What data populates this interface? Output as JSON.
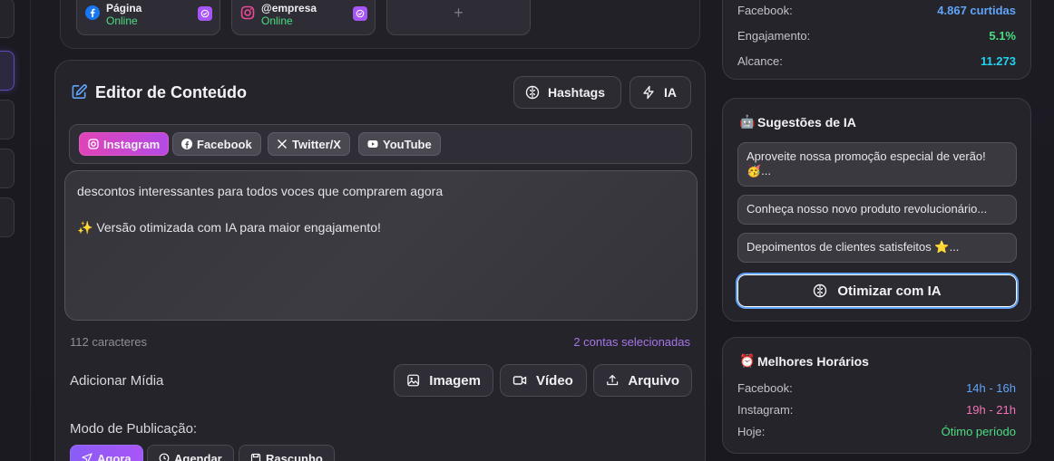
{
  "accounts": [
    {
      "name": "Página",
      "status": "Online",
      "network_icon": "facebook-icon",
      "checked": true
    },
    {
      "name": "@empresa",
      "status": "Online",
      "network_icon": "instagram-icon",
      "checked": true
    }
  ],
  "add_account_label": "+",
  "editor": {
    "title": "Editor de Conteúdo",
    "hashtags_label": "Hashtags",
    "ai_label": "IA",
    "networks": [
      {
        "label": "Instagram",
        "icon": "instagram-icon",
        "active": true
      },
      {
        "label": "Facebook",
        "icon": "facebook-icon",
        "active": false
      },
      {
        "label": "Twitter/X",
        "icon": "x-icon",
        "active": false
      },
      {
        "label": "YouTube",
        "icon": "youtube-icon",
        "active": false
      }
    ],
    "content_line1": "descontos interessantes para todos voces que comprarem agora",
    "content_line2": "✨ Versão otimizada com IA para maior engajamento!",
    "char_count": "112 caracteres",
    "selected_accounts": "2 contas selecionadas",
    "media_label": "Adicionar Mídia",
    "media_buttons": {
      "image": "Imagem",
      "video": "Vídeo",
      "file": "Arquivo"
    },
    "mode_label": "Modo de Publicação:",
    "modes": {
      "now": "Agora",
      "schedule": "Agendar",
      "draft": "Rascunho"
    }
  },
  "stats": {
    "rows": [
      {
        "label": "Facebook:",
        "value": "4.867 curtidas",
        "color": "#60a5fa"
      },
      {
        "label": "Engajamento:",
        "value": "5.1%",
        "color": "#4ade80"
      },
      {
        "label": "Alcance:",
        "value": "11.273",
        "color": "#22d3ee"
      }
    ]
  },
  "suggestions": {
    "title": "Sugestões de IA",
    "emoji": "🤖",
    "items": [
      "Aproveite nossa promoção especial de verão! 🥳...",
      "Conheça nosso novo produto revolucionário...",
      "Depoimentos de clientes satisfeitos ⭐..."
    ],
    "optimize_label": "Otimizar com IA"
  },
  "best_times": {
    "title": "Melhores Horários",
    "emoji": "⏰",
    "rows": [
      {
        "label": "Facebook:",
        "value": "14h - 16h",
        "color": "#60a5fa"
      },
      {
        "label": "Instagram:",
        "value": "19h - 21h",
        "color": "#f472b6"
      },
      {
        "label": "Hoje:",
        "value": "Ótimo período",
        "color": "#4ade80"
      }
    ]
  }
}
